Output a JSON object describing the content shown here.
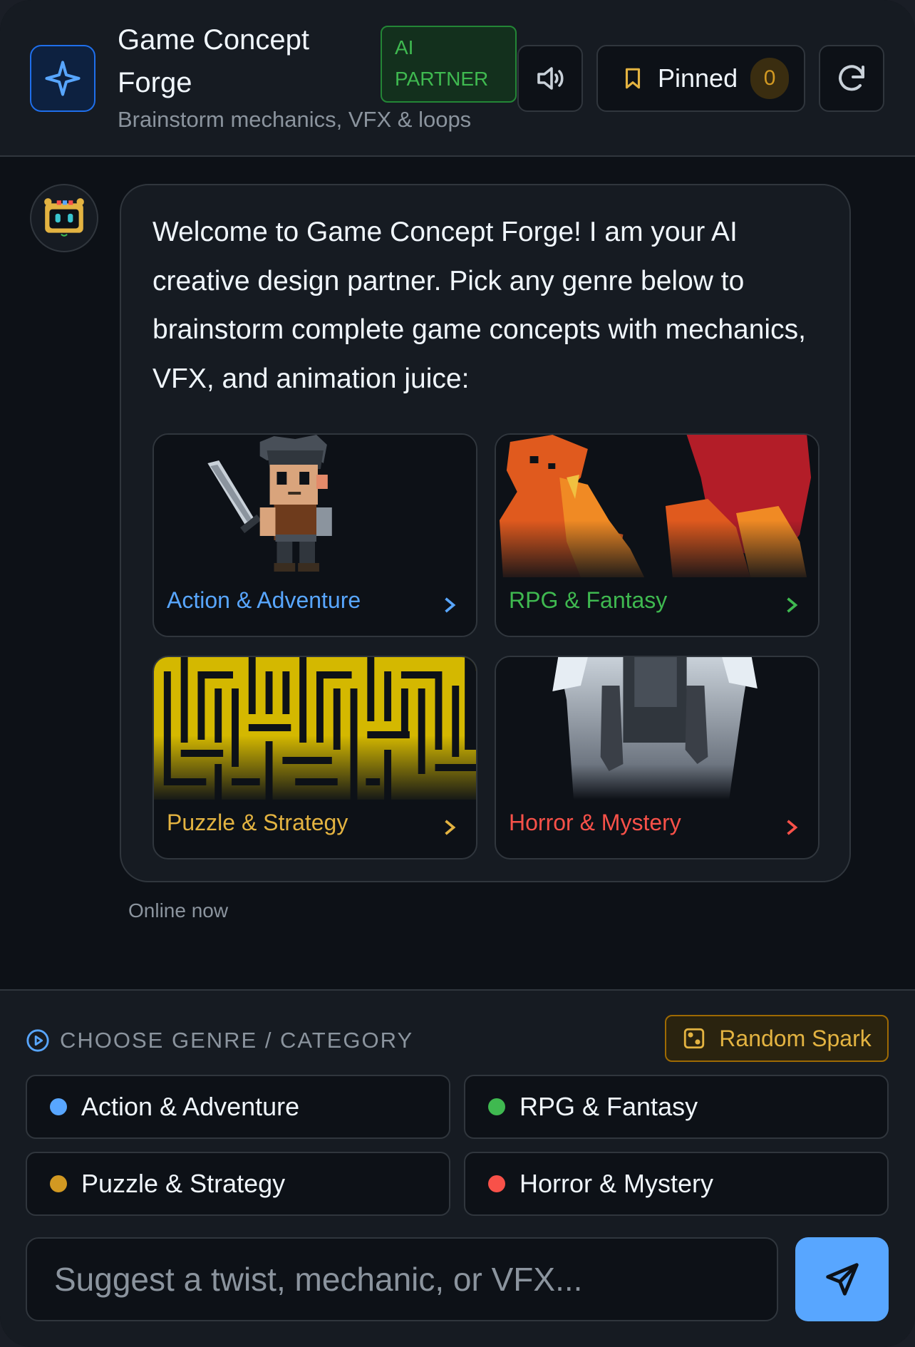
{
  "header": {
    "title": "Game Concept Forge",
    "subtitle": "Brainstorm mechanics, VFX & loops",
    "badge": "AI PARTNER",
    "pinned_label": "Pinned",
    "pinned_count": "0",
    "icons": [
      "sparkle-icon",
      "speaker-icon",
      "bookmark-icon",
      "refresh-icon"
    ]
  },
  "chat": {
    "message": "Welcome to Game Concept Forge! I am your AI creative design partner. Pick any genre below to brainstorm complete game concepts with mechanics, VFX, and animation juice:",
    "status": "Online now",
    "cards": [
      {
        "label": "Action & Adventure",
        "color": "#58a6ff",
        "art": "pixel-knight-with-sword"
      },
      {
        "label": "RPG & Fantasy",
        "color": "#3fb950",
        "art": "pixel-red-dragon"
      },
      {
        "label": "Puzzle & Strategy",
        "color": "#e3b341",
        "art": "yellow-maze"
      },
      {
        "label": "Horror & Mystery",
        "color": "#f85149",
        "art": "ghostly-figure"
      }
    ]
  },
  "genre_panel": {
    "heading": "CHOOSE GENRE / CATEGORY",
    "random_button": "Random Spark",
    "chips": [
      {
        "label": "Action & Adventure",
        "color": "#58a6ff"
      },
      {
        "label": "RPG & Fantasy",
        "color": "#3fb950"
      },
      {
        "label": "Puzzle & Strategy",
        "color": "#d29922"
      },
      {
        "label": "Horror & Mystery",
        "color": "#f85149"
      }
    ]
  },
  "composer": {
    "placeholder": "Suggest a twist, mechanic, or VFX...",
    "value": ""
  }
}
